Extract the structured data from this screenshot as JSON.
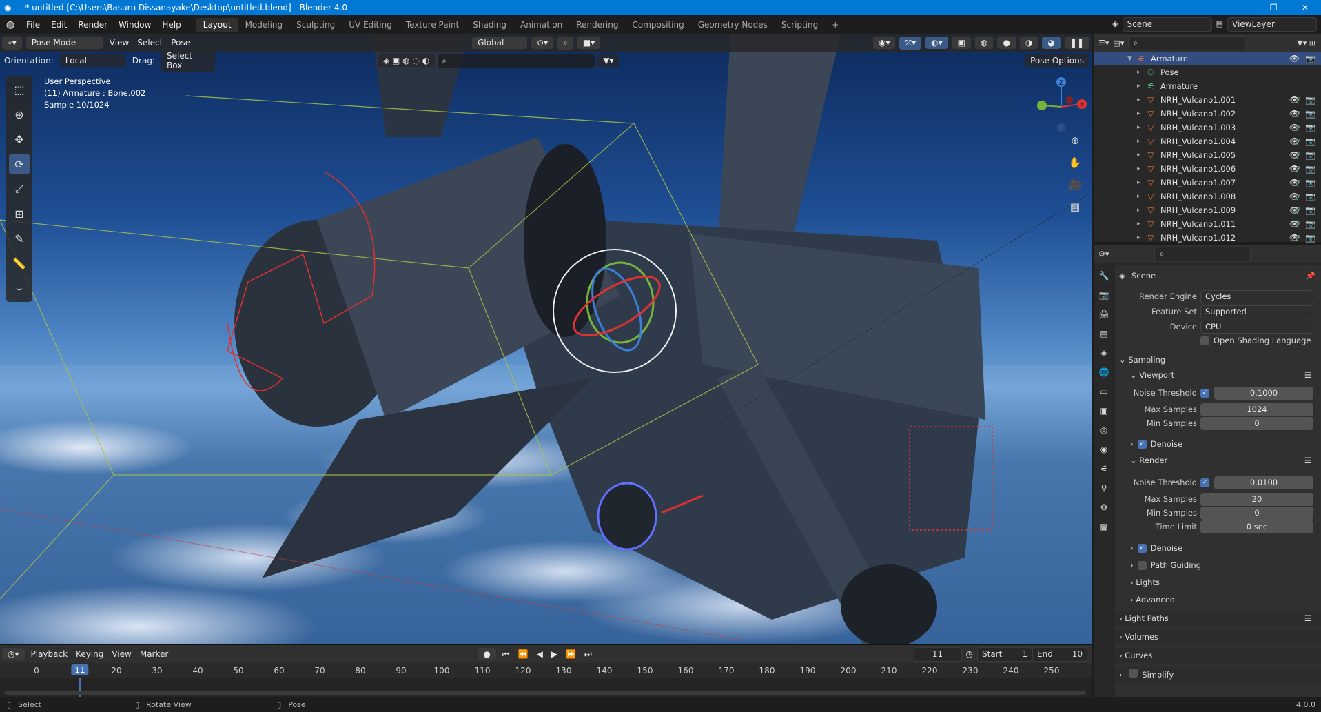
{
  "titlebar": {
    "title": "* untitled [C:\\Users\\Basuru Dissanayake\\Desktop\\untitled.blend] - Blender 4.0",
    "min": "—",
    "max": "❐",
    "close": "✕"
  },
  "menu": [
    "File",
    "Edit",
    "Render",
    "Window",
    "Help"
  ],
  "workspaces": [
    "Layout",
    "Modeling",
    "Sculpting",
    "UV Editing",
    "Texture Paint",
    "Shading",
    "Animation",
    "Rendering",
    "Compositing",
    "Geometry Nodes",
    "Scripting"
  ],
  "workspace_add": "+",
  "scene_field": "Scene",
  "viewlayer_field": "ViewLayer",
  "viewport_header": {
    "mode": "Pose Mode",
    "view": "View",
    "select": "Select",
    "pose": "Pose",
    "transform": "Global",
    "pose_options": "Pose Options"
  },
  "viewport_header2": {
    "orientation_label": "Orientation:",
    "orientation_value": "Local",
    "drag_label": "Drag:",
    "drag_value": "Select Box"
  },
  "viewport_info": {
    "line1": "User Perspective",
    "line2": "(11) Armature : Bone.002",
    "line3": "Sample 10/1024"
  },
  "gizmo": {
    "z": "Z",
    "y": "Y",
    "x": "X"
  },
  "outliner": {
    "root": "Armature",
    "items": [
      {
        "label": "Pose",
        "icon": "pose-icon"
      },
      {
        "label": "Armature",
        "icon": "armature-icon"
      },
      {
        "label": "NRH_Vulcano1.001",
        "icon": "mesh-icon"
      },
      {
        "label": "NRH_Vulcano1.002",
        "icon": "mesh-icon"
      },
      {
        "label": "NRH_Vulcano1.003",
        "icon": "mesh-icon"
      },
      {
        "label": "NRH_Vulcano1.004",
        "icon": "mesh-icon"
      },
      {
        "label": "NRH_Vulcano1.005",
        "icon": "mesh-icon"
      },
      {
        "label": "NRH_Vulcano1.006",
        "icon": "mesh-icon"
      },
      {
        "label": "NRH_Vulcano1.007",
        "icon": "mesh-icon"
      },
      {
        "label": "NRH_Vulcano1.008",
        "icon": "mesh-icon"
      },
      {
        "label": "NRH_Vulcano1.009",
        "icon": "mesh-icon"
      },
      {
        "label": "NRH_Vulcano1.011",
        "icon": "mesh-icon"
      },
      {
        "label": "NRH_Vulcano1.012",
        "icon": "mesh-icon"
      }
    ]
  },
  "properties": {
    "context": "Scene",
    "render_engine_label": "Render Engine",
    "render_engine": "Cycles",
    "feature_set_label": "Feature Set",
    "feature_set": "Supported",
    "device_label": "Device",
    "device": "CPU",
    "osl_label": "Open Shading Language",
    "sampling": "Sampling",
    "viewport": "Viewport",
    "noise_threshold_label": "Noise Threshold",
    "vp_noise": "0.1000",
    "max_samples_label": "Max Samples",
    "vp_max": "1024",
    "min_samples_label": "Min Samples",
    "vp_min": "0",
    "denoise": "Denoise",
    "render": "Render",
    "r_noise": "0.0100",
    "r_max": "20",
    "r_min": "0",
    "time_limit_label": "Time Limit",
    "r_time": "0 sec",
    "path_guiding": "Path Guiding",
    "lights": "Lights",
    "advanced": "Advanced",
    "light_paths": "Light Paths",
    "volumes": "Volumes",
    "curves": "Curves",
    "simplify": "Simplify"
  },
  "timeline": {
    "playback": "Playback",
    "keying": "Keying",
    "view": "View",
    "marker": "Marker",
    "current": "11",
    "start_label": "Start",
    "start": "1",
    "end_label": "End",
    "end": "10",
    "ticks": [
      "0",
      "20",
      "30",
      "40",
      "50",
      "60",
      "70",
      "80",
      "90",
      "100",
      "110",
      "120",
      "130",
      "140",
      "150",
      "160",
      "170",
      "180",
      "190",
      "200",
      "210",
      "220",
      "230",
      "240",
      "250"
    ]
  },
  "status": {
    "select": "Select",
    "rotate": "Rotate View",
    "pose": "Pose",
    "version": "4.0.0"
  }
}
